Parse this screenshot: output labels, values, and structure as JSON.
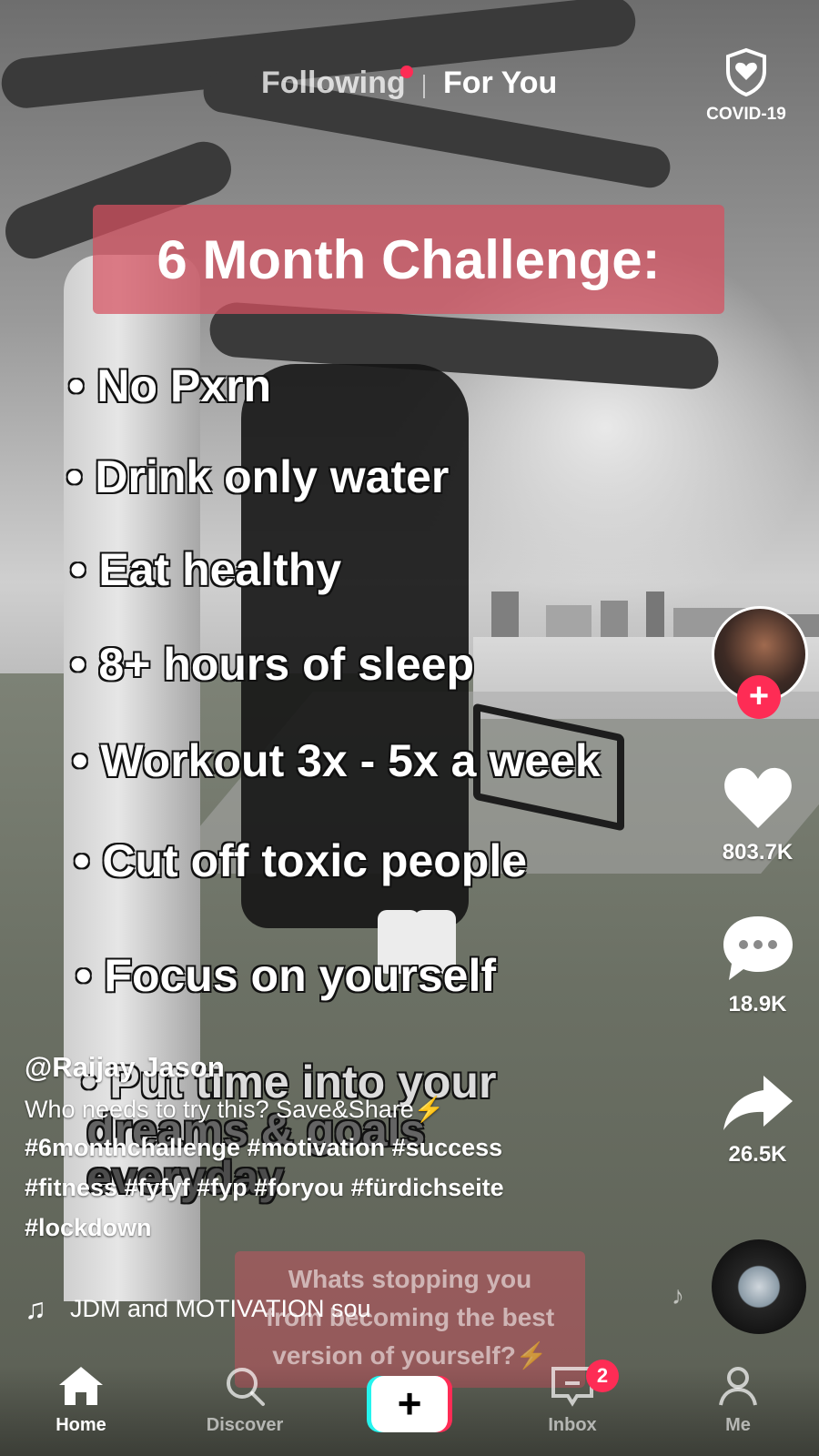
{
  "top_nav": {
    "following": "Following",
    "for_you": "For You",
    "covid_label": "COVID-19"
  },
  "overlay": {
    "title": "6 Month Challenge:",
    "items": [
      "• No Pxrn",
      "• Drink only water",
      "• Eat healthy",
      "• 8+ hours of sleep",
      "• Workout 3x - 5x a week",
      "• Cut off toxic people",
      "• Focus on yourself",
      "• Put time into your",
      "dreams & goals",
      "everyday"
    ],
    "faded_lines": [
      "Whats stopping you",
      "from becoming the best",
      "version of yourself?⚡"
    ]
  },
  "rail": {
    "likes": "803.7K",
    "comments": "18.9K",
    "shares": "26.5K"
  },
  "caption": {
    "username": "@Raijay Jason",
    "description": "Who needs to try this? Save&Share⚡",
    "hashtags_line1": "#6monthchallenge #motivation  #success",
    "hashtags_line2": "#fitness #fyfyf #fyp #foryou #fürdichseite",
    "hashtags_line3": "#lockdown",
    "sound": "JDM and MOTIVATION sou"
  },
  "bottom_nav": {
    "home": "Home",
    "discover": "Discover",
    "inbox": "Inbox",
    "inbox_badge": "2",
    "me": "Me"
  },
  "colors": {
    "accent": "#fe2c55",
    "cyan": "#25f4ee",
    "title_box": "#d65060"
  },
  "icons": [
    "heart-icon",
    "comment-icon",
    "share-icon",
    "home-icon",
    "search-icon",
    "plus-icon",
    "inbox-icon",
    "profile-icon",
    "music-note-icon",
    "shield-heart-icon"
  ]
}
